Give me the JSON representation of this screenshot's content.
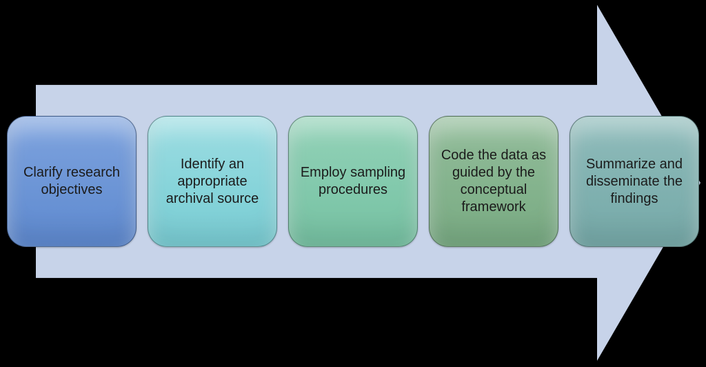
{
  "diagram": {
    "type": "process-arrow",
    "direction": "right",
    "arrow_color": "#c7d3e9",
    "steps": [
      {
        "label": "Clarify research objectives",
        "color": "#6c95d6"
      },
      {
        "label": "Identify an appropriate archival source",
        "color": "#87d4da"
      },
      {
        "label": "Employ sampling procedures",
        "color": "#82c9ac"
      },
      {
        "label": "Code the data as guided by the conceptual framework",
        "color": "#84b38d"
      },
      {
        "label": "Summarize and disseminate the findings",
        "color": "#80b1b0"
      }
    ]
  }
}
